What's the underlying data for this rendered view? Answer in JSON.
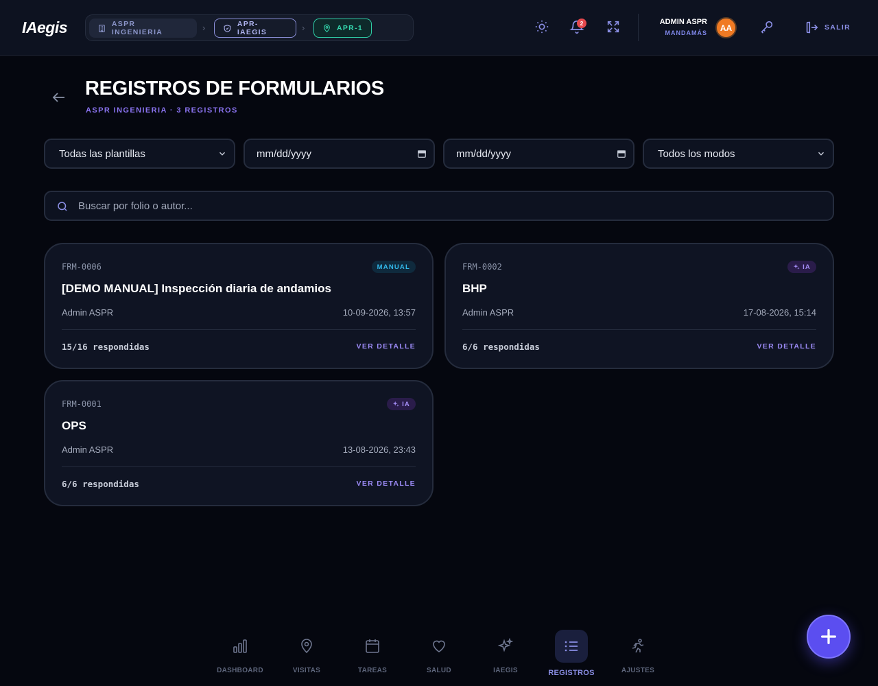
{
  "app": {
    "logo": "IAegis"
  },
  "breadcrumb": {
    "company": "ASPR INGENIERIA",
    "project": "APR-IAEGIS",
    "site": "APR-1"
  },
  "header": {
    "notifications_count": "2",
    "user_name": "ADMIN ASPR",
    "user_role": "MANDAMÁS",
    "avatar_initials": "AA",
    "logout_label": "SALIR"
  },
  "page": {
    "title": "REGISTROS DE FORMULARIOS",
    "subtitle": "ASPR INGENIERIA · 3 REGISTROS"
  },
  "filters": {
    "template": "Todas las plantillas",
    "date_from": "mm/dd/yyyy",
    "date_to": "mm/dd/yyyy",
    "mode": "Todos los modos"
  },
  "search": {
    "placeholder": "Buscar por folio o autor..."
  },
  "records": [
    {
      "folio": "FRM-0006",
      "badge": "MANUAL",
      "title": "[DEMO MANUAL] Inspección diaria de andamios",
      "author": "Admin ASPR",
      "date": "10-09-2026, 13:57",
      "answered": "15/16 respondidas",
      "detail_label": "VER DETALLE"
    },
    {
      "folio": "FRM-0002",
      "badge": "IA",
      "title": "BHP",
      "author": "Admin ASPR",
      "date": "17-08-2026, 15:14",
      "answered": "6/6 respondidas",
      "detail_label": "VER DETALLE"
    },
    {
      "folio": "FRM-0001",
      "badge": "IA",
      "title": "OPS",
      "author": "Admin ASPR",
      "date": "13-08-2026, 23:43",
      "answered": "6/6 respondidas",
      "detail_label": "VER DETALLE"
    }
  ],
  "nav": [
    {
      "label": "DASHBOARD",
      "icon": "bar-chart-icon"
    },
    {
      "label": "VISITAS",
      "icon": "map-pin-icon"
    },
    {
      "label": "TAREAS",
      "icon": "calendar-icon"
    },
    {
      "label": "SALUD",
      "icon": "heart-icon"
    },
    {
      "label": "IAEGIS",
      "icon": "sparkles-icon"
    },
    {
      "label": "REGISTROS",
      "icon": "list-icon",
      "active": true
    },
    {
      "label": "AJUSTES",
      "icon": "runner-icon"
    }
  ],
  "colors": {
    "background": "#05070f",
    "surface": "#0d1220",
    "accent": "#8b8fe6",
    "fab": "#5b4ef0",
    "manual_badge": "#32b8ea",
    "ia_badge": "#a48df5",
    "site_crumb": "#35d8ae"
  }
}
